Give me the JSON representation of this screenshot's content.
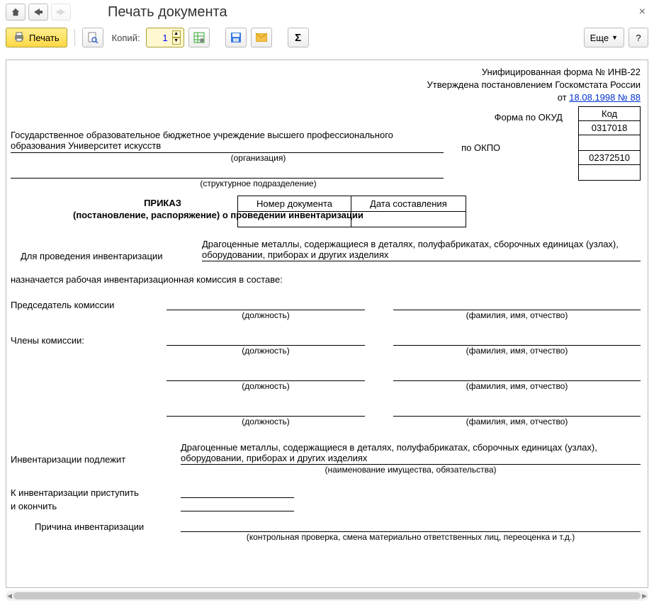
{
  "window": {
    "title": "Печать документа"
  },
  "toolbar": {
    "print_label": "Печать",
    "copies_label": "Копий:",
    "copies_value": "1",
    "more_label": "Еще",
    "help_label": "?"
  },
  "doc": {
    "unified_form": "Унифицированная форма № ИНВ-22",
    "approved_by": "Утверждена постановлением Госкомстата России",
    "approved_from_prefix": "от ",
    "approved_date": "18.08.1998 № 88",
    "codes": {
      "header": "Код",
      "okud_label": "Форма по ОКУД",
      "okud_value": "0317018",
      "okpo_label": "по ОКПО",
      "okpo_value": "02372510"
    },
    "organization": "Государственное образовательное бюджетное учреждение высшего профессионального образования Университет искусств",
    "organization_caption": "(организация)",
    "subdivision_caption": "(структурное подразделение)",
    "form_headers": {
      "number": "Номер документа",
      "date": "Дата составления"
    },
    "order_title": "ПРИКАЗ",
    "order_subtitle": "(постановление, распоряжение) о проведении инвентаризации",
    "for_label": "Для проведения инвентаризации",
    "for_value": "Драгоценные металлы, содержащиеся в деталях, полуфабрикатах, сборочных единицах (узлах), оборудовании, приборах и других изделиях",
    "commission_line": "назначается рабочая инвентаризационная комиссия в составе:",
    "chairman_label": "Председатель комиссии",
    "members_label": "Члены комиссии:",
    "position_caption": "(должность)",
    "fio_caption": "(фамилия, имя, отчество)",
    "subject_label": "Инвентаризации подлежит",
    "subject_value": "Драгоценные металлы, содержащиеся в деталях, полуфабрикатах, сборочных единицах (узлах), оборудовании, приборах и других изделиях",
    "subject_caption": "(наименование имущества, обязательства)",
    "start_label": "К инвентаризации приступить",
    "end_label": "и окончить",
    "reason_label": "Причина инвентаризации",
    "reason_caption": "(контрольная проверка, смена материально ответственных лиц, переоценка и т.д.)"
  }
}
